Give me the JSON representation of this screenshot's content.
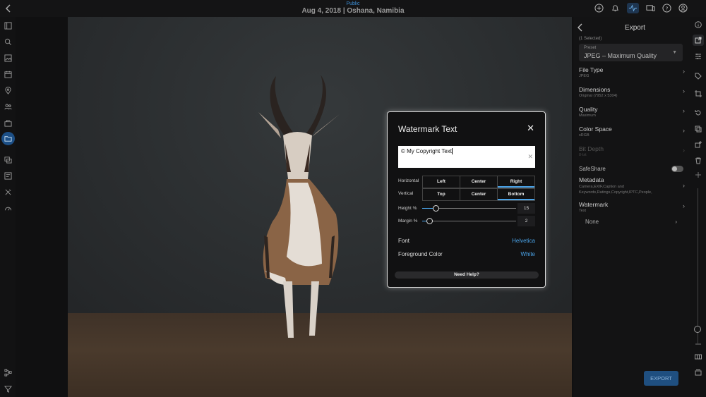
{
  "header": {
    "visibility": "Public",
    "title": "Aug 4, 2018 | Oshana, Namibia"
  },
  "export_panel": {
    "title": "Export",
    "selected_count": "(1 Selected)",
    "preset": {
      "label": "Preset",
      "value": "JPEG – Maximum Quality"
    },
    "rows": [
      {
        "label": "File Type",
        "sub": "JPEG"
      },
      {
        "label": "Dimensions",
        "sub": "Original (7952 x 5304)"
      },
      {
        "label": "Quality",
        "sub": "Maximum"
      },
      {
        "label": "Color Space",
        "sub": "sRGB"
      },
      {
        "label": "Bit Depth",
        "sub": "8-bit"
      }
    ],
    "safeshare_label": "SafeShare",
    "metadata": {
      "label": "Metadata",
      "sub": "Camera,EXIF,Caption and Keywords,Ratings,Copyright,IPTC,People,"
    },
    "watermark": {
      "label": "Watermark",
      "sub": "Text",
      "value": "None"
    },
    "export_button": "EXPORT"
  },
  "dialog": {
    "title": "Watermark Text",
    "close_symbol": "✕",
    "text_value": "© My Copyright Text",
    "clear_symbol": "✕",
    "horizontal": {
      "label": "Horizontal",
      "options": [
        "Left",
        "Center",
        "Right"
      ],
      "selected": "Right"
    },
    "vertical": {
      "label": "Vertical",
      "options": [
        "Top",
        "Center",
        "Bottom"
      ],
      "selected": "Bottom"
    },
    "height": {
      "label": "Height %",
      "value": "15",
      "fraction": 0.15
    },
    "margin": {
      "label": "Margin %",
      "value": "2",
      "fraction": 0.08
    },
    "font": {
      "label": "Font",
      "value": "Helvetica"
    },
    "foreground": {
      "label": "Foreground Color",
      "value": "White"
    },
    "help_button": "Need Help?"
  },
  "colors": {
    "accent": "#4aa3e8",
    "export_button_bg": "#1f4f80",
    "active_nav": "#1c4f86"
  }
}
